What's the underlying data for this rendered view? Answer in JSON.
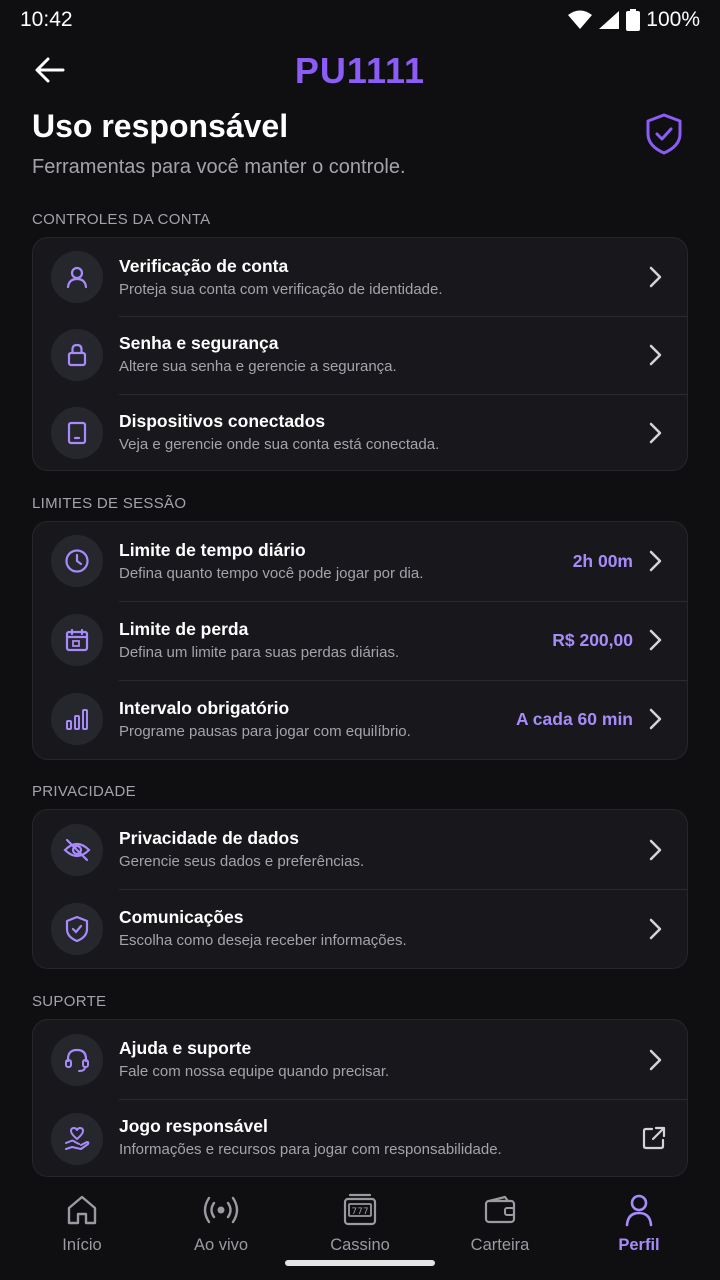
{
  "status": {
    "time": "10:42",
    "battery": "100%"
  },
  "header": {
    "brand": "PU1111",
    "title": "Uso responsável",
    "subtitle": "Ferramentas para você manter o controle."
  },
  "sections": {
    "account": {
      "label": "CONTROLES DA CONTA",
      "items": [
        {
          "title": "Verificação de conta",
          "subtitle": "Proteja sua conta com verificação de identidade.",
          "icon": "user-icon"
        },
        {
          "title": "Senha e segurança",
          "subtitle": "Altere sua senha e gerencie a segurança.",
          "icon": "lock-icon"
        },
        {
          "title": "Dispositivos conectados",
          "subtitle": "Veja e gerencie onde sua conta está conectada.",
          "icon": "tablet-icon"
        }
      ]
    },
    "limits": {
      "label": "LIMITES DE SESSÃO",
      "items": [
        {
          "title": "Limite de tempo diário",
          "subtitle": "Defina quanto tempo você pode jogar por dia.",
          "value": "2h 00m",
          "icon": "clock-icon"
        },
        {
          "title": "Limite de perda",
          "subtitle": "Defina um limite para suas perdas diárias.",
          "value": "R$ 200,00",
          "icon": "calendar-icon"
        },
        {
          "title": "Intervalo obrigatório",
          "subtitle": "Programe pausas para jogar com equilíbrio.",
          "value": "A cada 60 min",
          "icon": "bar-chart-icon"
        }
      ]
    },
    "privacy": {
      "label": "PRIVACIDADE",
      "items": [
        {
          "title": "Privacidade de dados",
          "subtitle": "Gerencie seus dados e preferências.",
          "icon": "eye-off-icon"
        },
        {
          "title": "Comunicações",
          "subtitle": "Escolha como deseja receber informações.",
          "icon": "shield-check-icon"
        }
      ]
    },
    "support": {
      "label": "SUPORTE",
      "items": [
        {
          "title": "Ajuda e suporte",
          "subtitle": "Fale com nossa equipe quando precisar.",
          "icon": "headset-icon"
        },
        {
          "title": "Jogo responsável",
          "subtitle": "Informações e recursos para jogar com responsabilidade.",
          "icon": "heart-hand-icon"
        }
      ]
    }
  },
  "nav": [
    {
      "label": "Início",
      "icon": "home-icon"
    },
    {
      "label": "Ao vivo",
      "icon": "broadcast-icon"
    },
    {
      "label": "Cassino",
      "icon": "slot-machine-icon"
    },
    {
      "label": "Carteira",
      "icon": "wallet-icon"
    },
    {
      "label": "Perfil",
      "icon": "profile-icon",
      "active": true
    }
  ],
  "colors": {
    "accent": "#8b5cf6",
    "accent_light": "#a78bfa",
    "background": "#0f0f11",
    "card": "#18181c"
  }
}
